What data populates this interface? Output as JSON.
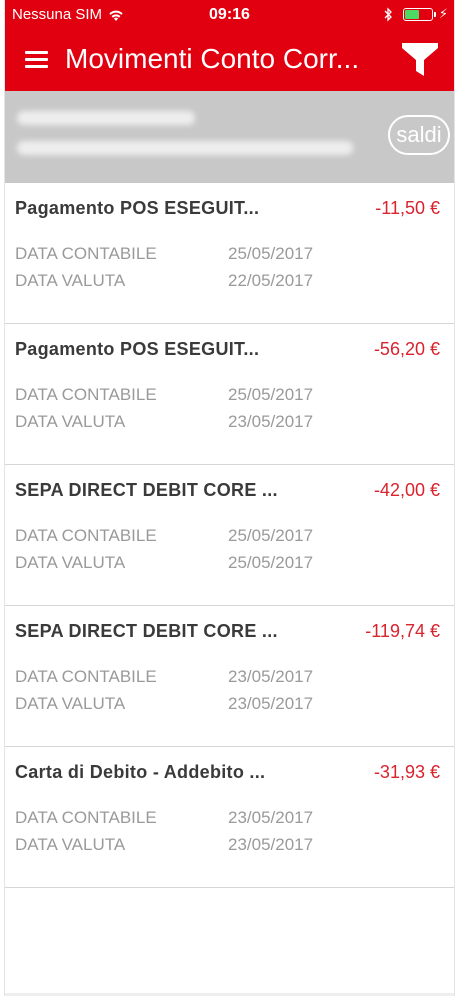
{
  "status_bar": {
    "carrier": "Nessuna SIM",
    "time": "09:16",
    "charging_symbol": "⚡"
  },
  "nav": {
    "title": "Movimenti Conto Corr...",
    "menu_icon": "hamburger-menu-icon",
    "filter_icon": "filter-funnel-icon"
  },
  "account": {
    "saldi_label": "saldi"
  },
  "labels": {
    "data_contabile": "DATA CONTABILE",
    "data_valuta": "DATA VALUTA"
  },
  "colors": {
    "header_red": "#e1000f",
    "amount_red": "#d9232e",
    "band_gray": "#c8c8c8"
  },
  "transactions": [
    {
      "description": "Pagamento POS ESEGUIT...",
      "amount": "-11,50 €",
      "data_contabile": "25/05/2017",
      "data_valuta": "22/05/2017"
    },
    {
      "description": "Pagamento POS ESEGUIT...",
      "amount": "-56,20 €",
      "data_contabile": "25/05/2017",
      "data_valuta": "23/05/2017"
    },
    {
      "description": "SEPA DIRECT DEBIT CORE ...",
      "amount": "-42,00 €",
      "data_contabile": "25/05/2017",
      "data_valuta": "25/05/2017"
    },
    {
      "description": "SEPA DIRECT DEBIT CORE ...",
      "amount": "-119,74 €",
      "data_contabile": "23/05/2017",
      "data_valuta": "23/05/2017"
    },
    {
      "description": "Carta di Debito - Addebito ...",
      "amount": "-31,93 €",
      "data_contabile": "23/05/2017",
      "data_valuta": "23/05/2017"
    }
  ]
}
